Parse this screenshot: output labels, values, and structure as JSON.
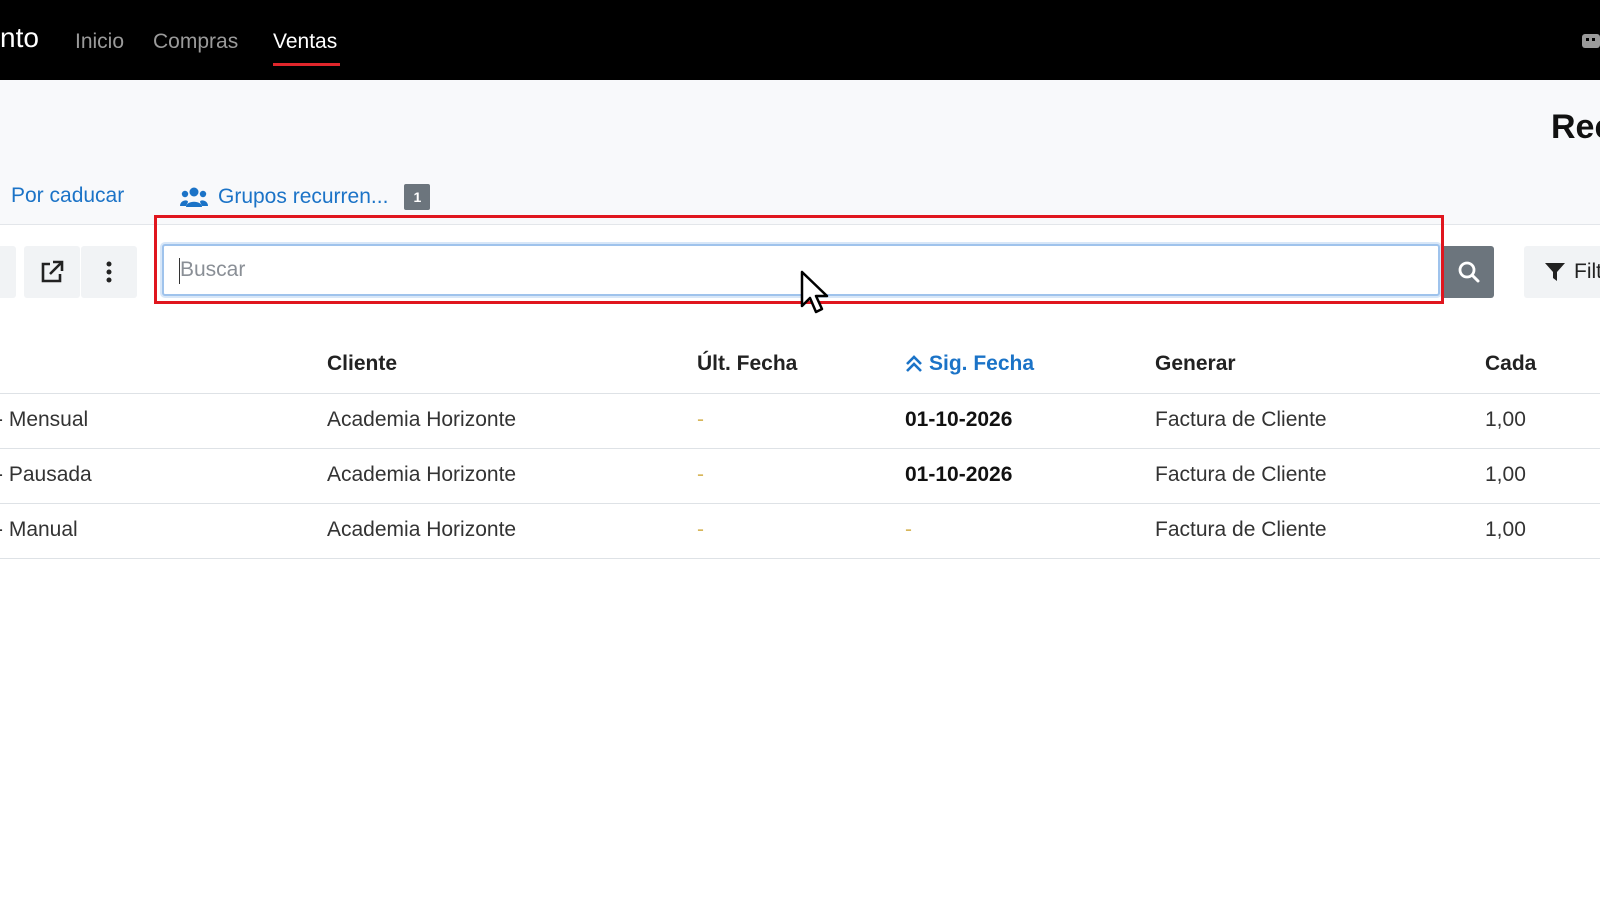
{
  "navbar": {
    "brand": "nto",
    "items": [
      {
        "label": "Inicio",
        "active": false
      },
      {
        "label": "Compras",
        "active": false
      },
      {
        "label": "Ventas",
        "active": true
      }
    ],
    "accent": "#e0262b"
  },
  "header": {
    "title": "Rec",
    "tabs": [
      {
        "label": "Por caducar",
        "icon": null
      },
      {
        "label": "Grupos recurren...",
        "icon": "users-icon",
        "badge": "1"
      }
    ]
  },
  "toolbar": {
    "export_icon": "external-link-icon",
    "more_icon": "vertical-dots-icon",
    "search": {
      "placeholder": "Buscar",
      "value": ""
    },
    "search_button_icon": "search-icon",
    "filter_label": "Filt",
    "filter_icon": "filter-icon"
  },
  "table": {
    "columns": [
      {
        "label": "Cliente",
        "sorted": false
      },
      {
        "label": "Últ. Fecha",
        "sorted": false
      },
      {
        "label": "Sig. Fecha",
        "sorted": true,
        "sort_icon": "double-chevron-up-icon"
      },
      {
        "label": "Generar",
        "sorted": false
      },
      {
        "label": "Cada",
        "sorted": false
      }
    ],
    "rows": [
      {
        "name": "- Mensual",
        "cliente": "Academia Horizonte",
        "ult_fecha": "-",
        "sig_fecha": "01-10-2026",
        "generar": "Factura de Cliente",
        "cada": "1,00"
      },
      {
        "name": "- Pausada",
        "cliente": "Academia Horizonte",
        "ult_fecha": "-",
        "sig_fecha": "01-10-2026",
        "generar": "Factura de Cliente",
        "cada": "1,00"
      },
      {
        "name": "- Manual",
        "cliente": "Academia Horizonte",
        "ult_fecha": "-",
        "sig_fecha": "-",
        "generar": "Factura de Cliente",
        "cada": "1,00"
      }
    ]
  },
  "colors": {
    "link": "#1b73c7",
    "highlight": "#e0161e",
    "muted_dash": "#d7b65a",
    "badge": "#6c757d"
  }
}
